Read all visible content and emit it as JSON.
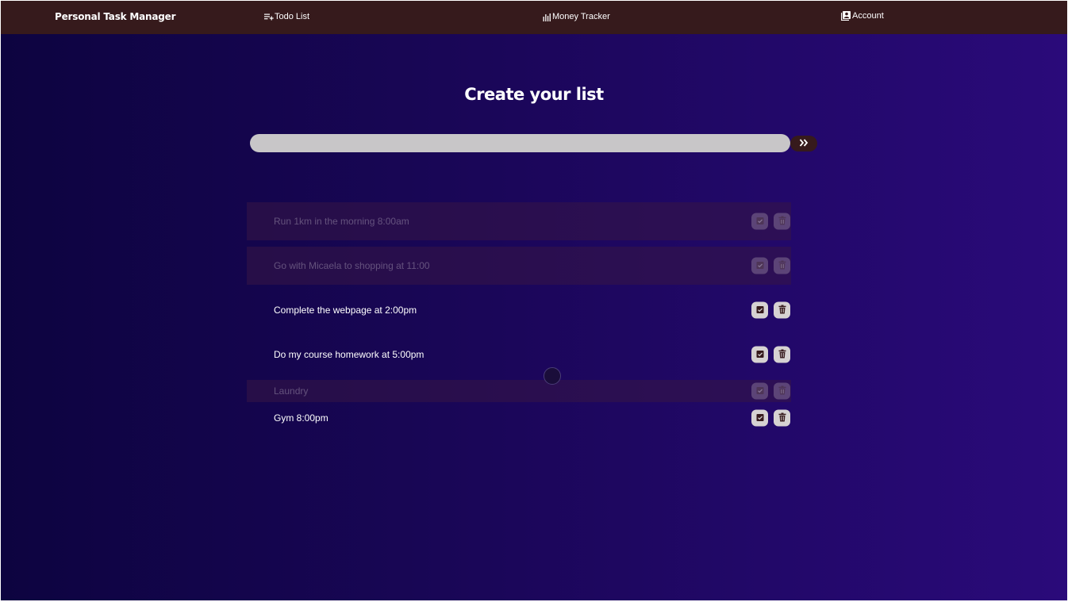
{
  "navbar": {
    "brand": "Personal Task Manager",
    "links": [
      {
        "label": "Todo List",
        "icon": "playlist-add-icon"
      },
      {
        "label": "Money Tracker",
        "icon": "bar-chart-icon"
      },
      {
        "label": "Account",
        "icon": "account-box-icon"
      }
    ]
  },
  "main": {
    "title": "Create your list",
    "input_value": "",
    "submit_icon": "double-chevron-right-icon"
  },
  "tasks": [
    {
      "text": "Run 1km in the morning 8:00am",
      "completed": true
    },
    {
      "text": "Go with Micaela to shopping at 11:00",
      "completed": true
    },
    {
      "text": "Complete the webpage at 2:00pm",
      "completed": false
    },
    {
      "text": "Do my course homework at 5:00pm",
      "completed": false
    },
    {
      "text": "Laundry",
      "completed": true
    },
    {
      "text": "Gym 8:00pm",
      "completed": false
    }
  ],
  "colors": {
    "navbar": "#361a1c",
    "input": "#c8c6c8",
    "gradient_start": "#0d0440",
    "gradient_end": "#2a0a7a"
  }
}
